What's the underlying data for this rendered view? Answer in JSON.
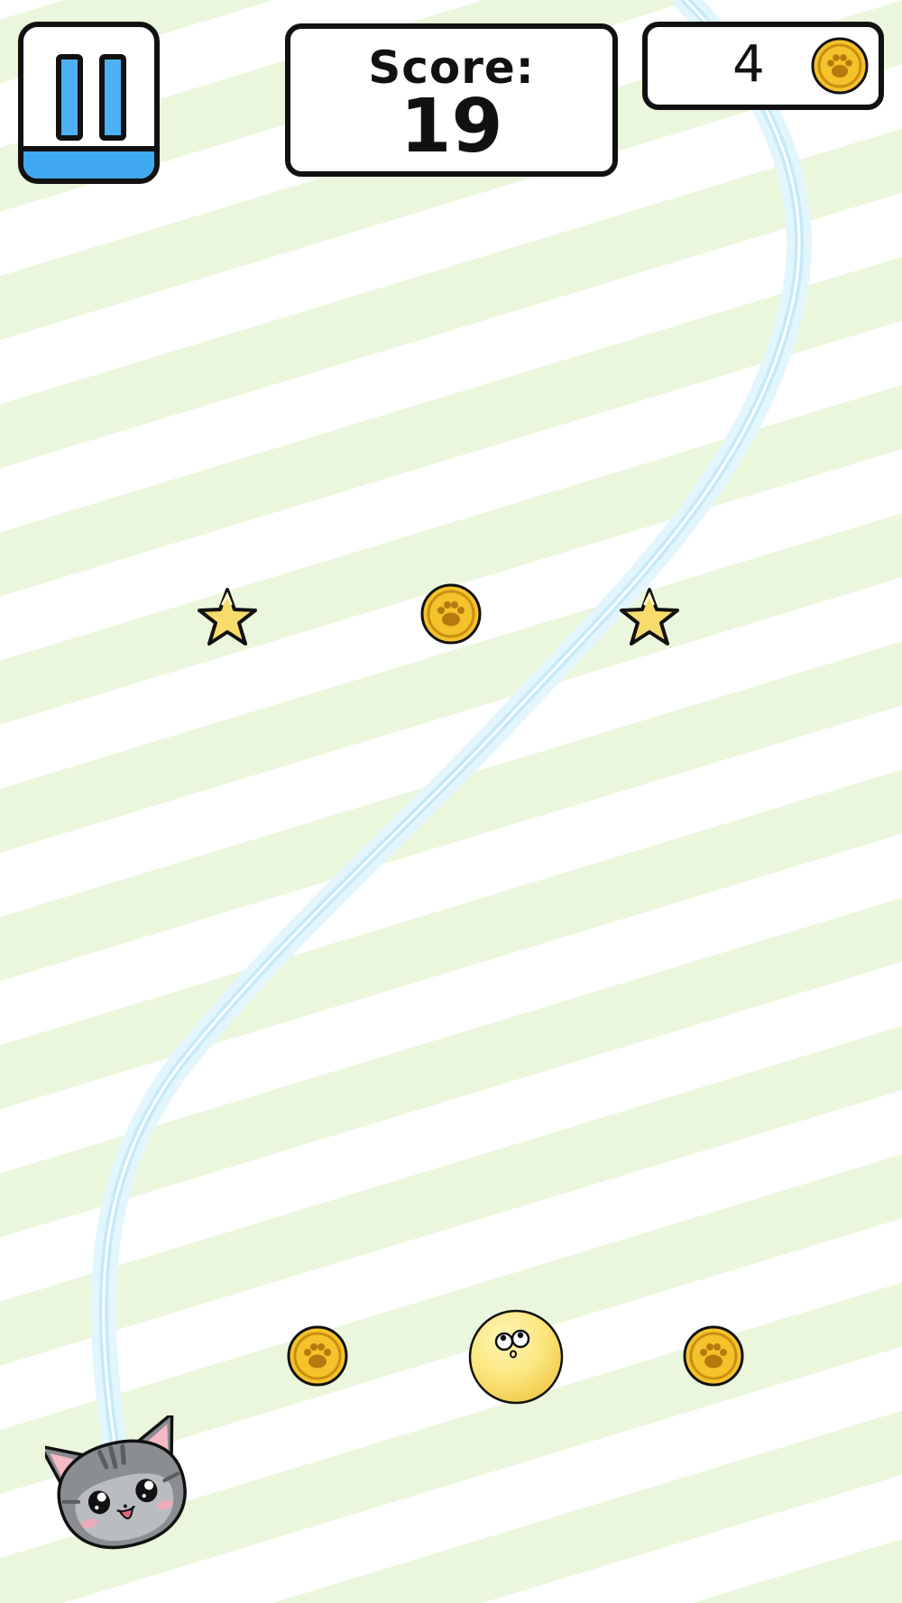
{
  "hud": {
    "score_label": "Score:",
    "score_value": "19",
    "coin_count": "4",
    "pause_icon": "pause-icon",
    "coin_icon": "paw-coin-icon"
  },
  "colors": {
    "stripe_green": "#ebf7dc",
    "pause_blue": "#4db0f2",
    "coin_gold": "#f4c22b",
    "star_yellow": "#f7dc6b",
    "ball_yellow": "#fbe57a",
    "trail_blue": "#cdeefb",
    "cat_gray": "#8a8d91"
  },
  "playfield": {
    "items": [
      {
        "kind": "star",
        "icon": "star-icon"
      },
      {
        "kind": "coin",
        "icon": "paw-coin-icon"
      },
      {
        "kind": "star",
        "icon": "star-icon"
      },
      {
        "kind": "coin",
        "icon": "paw-coin-icon"
      },
      {
        "kind": "ball",
        "icon": "yellow-ball-face-icon"
      },
      {
        "kind": "coin",
        "icon": "paw-coin-icon"
      }
    ],
    "player": "cat-head-icon",
    "trail": "aim-trajectory-line"
  }
}
